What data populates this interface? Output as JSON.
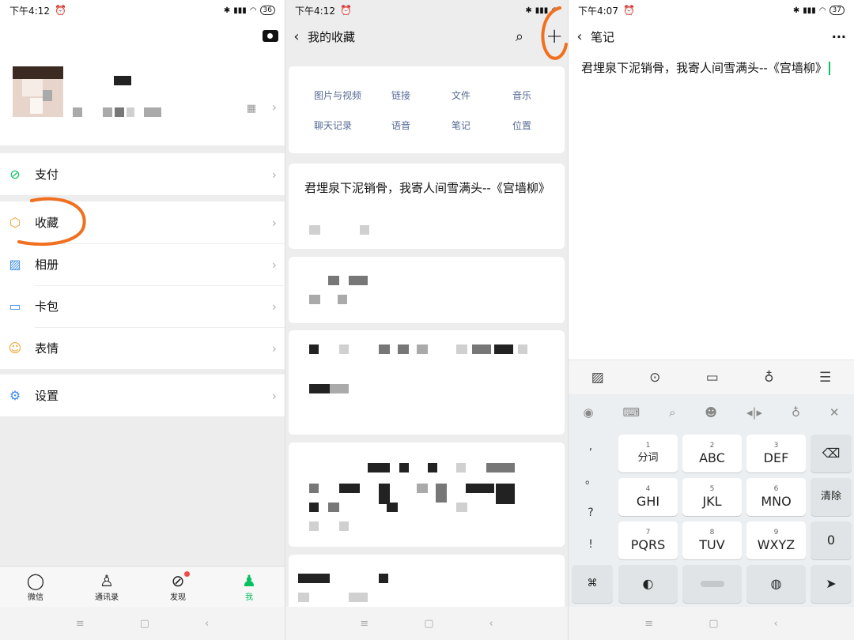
{
  "panel1": {
    "status": {
      "time": "下午4:12",
      "battery": "36"
    },
    "menu": [
      {
        "label": "支付"
      },
      {
        "label": "收藏"
      },
      {
        "label": "相册"
      },
      {
        "label": "卡包"
      },
      {
        "label": "表情"
      },
      {
        "label": "设置"
      }
    ],
    "tabs": [
      {
        "label": "微信"
      },
      {
        "label": "通讯录"
      },
      {
        "label": "发现"
      },
      {
        "label": "我"
      }
    ]
  },
  "panel2": {
    "status": {
      "time": "下午4:12"
    },
    "title": "我的收藏",
    "filters": [
      "图片与视频",
      "链接",
      "文件",
      "音乐",
      "聊天记录",
      "语音",
      "笔记",
      "位置"
    ],
    "first_card_text": "君埋泉下泥销骨，我寄人间雪满头--《宫墙柳》"
  },
  "panel3": {
    "status": {
      "time": "下午4:07",
      "battery": "37"
    },
    "title": "笔记",
    "more": "···",
    "note_text": "君埋泉下泥销骨，我寄人间雪满头--《宫墙柳》",
    "symbols": [
      ",",
      "。",
      "?",
      "!"
    ],
    "keys": [
      {
        "num": "1",
        "label": "分词"
      },
      {
        "num": "2",
        "label": "ABC"
      },
      {
        "num": "3",
        "label": "DEF"
      },
      {
        "num": "4",
        "label": "GHI"
      },
      {
        "num": "5",
        "label": "JKL"
      },
      {
        "num": "6",
        "label": "MNO"
      },
      {
        "num": "7",
        "label": "PQRS"
      },
      {
        "num": "8",
        "label": "TUV"
      },
      {
        "num": "9",
        "label": "WXYZ"
      }
    ],
    "side_keys": {
      "clear": "清除",
      "zero": "0"
    }
  },
  "colors": {
    "accent_green": "#07c160",
    "annotation_orange": "#f07020",
    "link_blue": "#576b95"
  }
}
